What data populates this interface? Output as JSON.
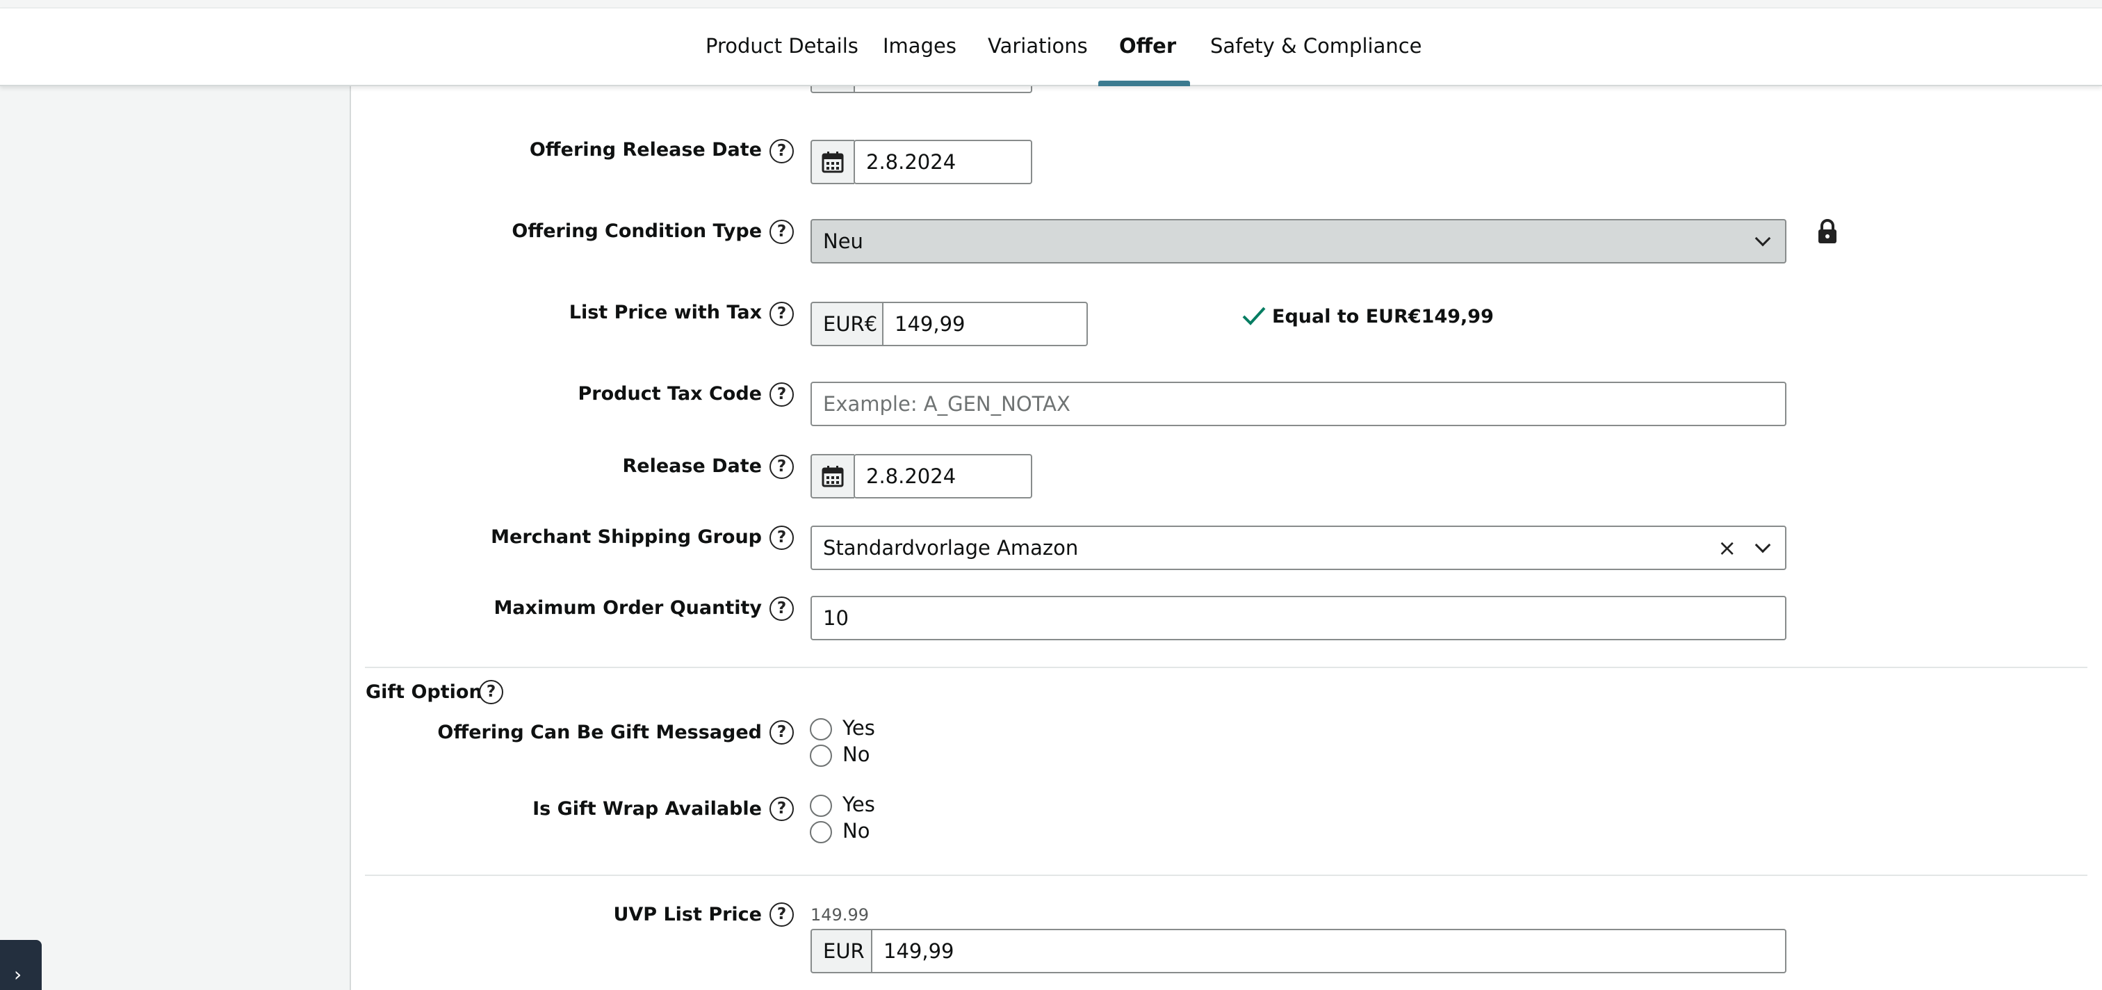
{
  "tabs": [
    {
      "label": "Product Details",
      "active": false
    },
    {
      "label": "Images",
      "active": false
    },
    {
      "label": "Variations",
      "active": false
    },
    {
      "label": "Offer",
      "active": true
    },
    {
      "label": "Safety & Compliance",
      "active": false
    }
  ],
  "fields": {
    "offering_release_date": {
      "label": "Offering Release Date",
      "value": "2.8.2024"
    },
    "offering_condition_type": {
      "label": "Offering Condition Type",
      "value": "Neu",
      "locked": true
    },
    "list_price_with_tax": {
      "label": "List Price with Tax",
      "currency": "EUR€",
      "value": "149,99",
      "validation": "Equal to EUR€149,99"
    },
    "product_tax_code": {
      "label": "Product Tax Code",
      "placeholder": "Example: A_GEN_NOTAX"
    },
    "release_date": {
      "label": "Release Date",
      "value": "2.8.2024"
    },
    "merchant_shipping_group": {
      "label": "Merchant Shipping Group",
      "value": "Standardvorlage Amazon",
      "clear_glyph": "×"
    },
    "maximum_order_quantity": {
      "label": "Maximum Order Quantity",
      "value": "10"
    }
  },
  "gift_options": {
    "heading": "Gift Options",
    "gift_message": {
      "label": "Offering Can Be Gift Messaged",
      "options": [
        "Yes",
        "No"
      ]
    },
    "gift_wrap": {
      "label": "Is Gift Wrap Available",
      "options": [
        "Yes",
        "No"
      ]
    }
  },
  "uvp": {
    "label": "UVP List Price",
    "current": "149.99",
    "currency": "EUR",
    "value": "149,99"
  },
  "icons": {
    "help": "?",
    "sidebar_toggle": "›",
    "lock": "lock-icon",
    "calendar": "calendar-icon",
    "check": "checkmark-icon"
  },
  "colors": {
    "accent": "#3b7a8f",
    "check": "#067d62",
    "sidebar_toggle": "#232f3e"
  }
}
